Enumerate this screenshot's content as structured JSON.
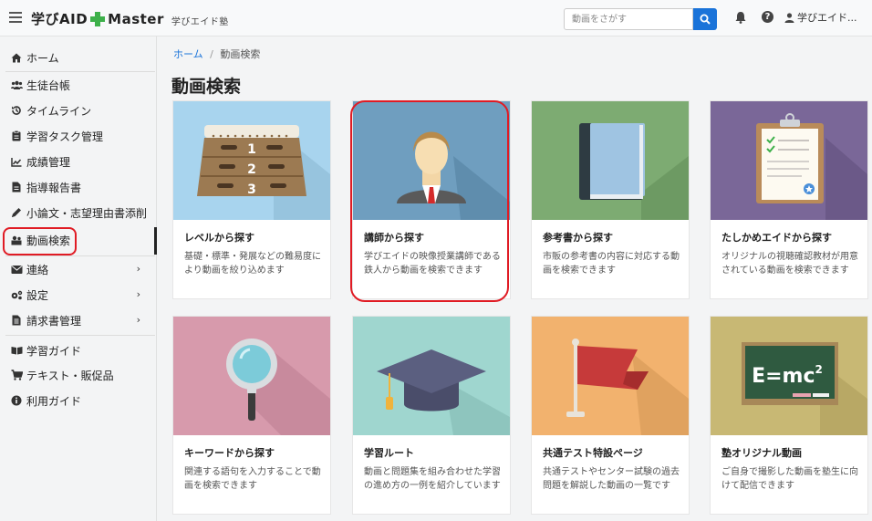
{
  "header": {
    "logo_text_1": "学びAID",
    "logo_text_2": "Master",
    "school": "学びエイド塾",
    "search_placeholder": "動画をさがす",
    "user": "学びエイド..."
  },
  "sidebar": {
    "items": [
      {
        "label": "ホーム",
        "icon": "home-icon"
      },
      {
        "label": "生徒台帳",
        "icon": "users-icon"
      },
      {
        "label": "タイムライン",
        "icon": "history-icon"
      },
      {
        "label": "学習タスク管理",
        "icon": "clipboard-icon"
      },
      {
        "label": "成績管理",
        "icon": "chart-icon"
      },
      {
        "label": "指導報告書",
        "icon": "file-icon"
      },
      {
        "label": "小論文・志望理由書添削",
        "icon": "pen-icon"
      },
      {
        "label": "動画検索",
        "icon": "video-search-icon"
      },
      {
        "label": "連絡",
        "icon": "mail-icon"
      },
      {
        "label": "設定",
        "icon": "settings-icon"
      },
      {
        "label": "請求書管理",
        "icon": "invoice-icon"
      },
      {
        "label": "学習ガイド",
        "icon": "book-icon"
      },
      {
        "label": "テキスト・販促品",
        "icon": "cart-icon"
      },
      {
        "label": "利用ガイド",
        "icon": "info-icon"
      }
    ]
  },
  "breadcrumb": {
    "home": "ホーム",
    "sep": "/",
    "current": "動画検索"
  },
  "page_title": "動画検索",
  "cards": [
    {
      "title": "レベルから探す",
      "desc": "基礎・標準・発展などの難易度により動画を絞り込めます",
      "color": "#a8d4ee"
    },
    {
      "title": "講師から探す",
      "desc": "学びエイドの映像授業講師である鉄人から動画を検索できます",
      "color": "#6f9ebf"
    },
    {
      "title": "参考書から探す",
      "desc": "市販の参考書の内容に対応する動画を検索できます",
      "color": "#7dab72"
    },
    {
      "title": "たしかめエイドから探す",
      "desc": "オリジナルの視聴確認教材が用意されている動画を検索できます",
      "color": "#7a6798"
    },
    {
      "title": "キーワードから探す",
      "desc": "関連する語句を入力することで動画を検索できます",
      "color": "#d79aac"
    },
    {
      "title": "学習ルート",
      "desc": "動画と問題集を組み合わせた学習の進め方の一例を紹介しています",
      "color": "#9fd6cf"
    },
    {
      "title": "共通テスト特設ページ",
      "desc": "共通テストやセンター試験の過去問題を解説した動画の一覧です",
      "color": "#f2b26e"
    },
    {
      "title": "塾オリジナル動画",
      "desc": "ご自身で撮影した動画を塾生に向けて配信できます",
      "color": "#c8b874"
    }
  ],
  "thumb_text": {
    "step_1": "1",
    "step_2": "2",
    "step_3": "3",
    "formula": "E=mc",
    "formula_sup": "2"
  }
}
